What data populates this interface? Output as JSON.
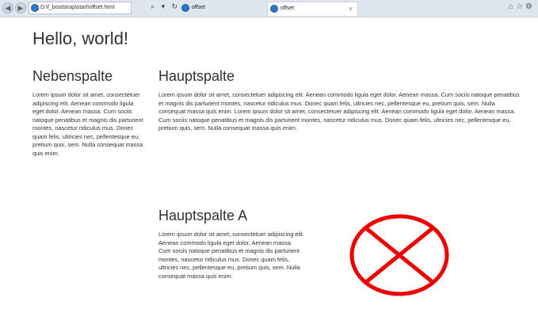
{
  "browser": {
    "address": "D:\\f_bootstrap\\start\\offset.html",
    "tab_inactive_title": "offset",
    "tab_active_title": "offset",
    "close_glyph": "×"
  },
  "page": {
    "heading": "Hello, world!",
    "side_title": "Nebenspalte",
    "side_text": "Lorem ipsum dolor sit amet, consectetuer adipiscing elit. Aenean commodo ligula eget dolor. Aenean massa. Cum sociis natoque penatibus et magnis dis parturient montes, nascetur ridiculus mus. Donec quam felis, ultricies nec, pellentesque eu, pretium quis, sem. Nulla consequat massa quis enim.",
    "main_title": "Hauptspalte",
    "main_text": "Lorem ipsum dolor sit amet, consectetuer adipiscing elit. Aenean commodo ligula eget dolor. Aenean massa. Cum sociis natoque penatibus et magnis dis parturient montes, nascetur ridiculus mus. Donec quam felis, ultricies nec, pellentesque eu, pretium quis, sem. Nulla consequat massa quis enim. Lorem ipsum dolor sit amet, consectetuer adipiscing elit. Aenean commodo ligula eget dolor. Aenean massa. Cum sociis natoque penatibus et magnis dis parturient montes, nascetur ridiculus mus. Donec quam felis, ultricies nec, pellentesque eu, pretium quis, sem. Nulla consequat massa quis enim.",
    "main_a_title": "Hauptspalte A",
    "main_a_text": "Lorem ipsum dolor sit amet, consectetuer adipiscing elit. Aenean commodo ligula eget dolor. Aenean massa. Cum sociis natoque penatibus et magnis dis parturient montes, nascetur ridiculus mus. Donec quam felis, ultricies nec, pellentesque eu, pretium quis, sem. Nulla consequat massa quis enim."
  },
  "icons": {
    "crossed_circle_color": "#ee0000"
  }
}
